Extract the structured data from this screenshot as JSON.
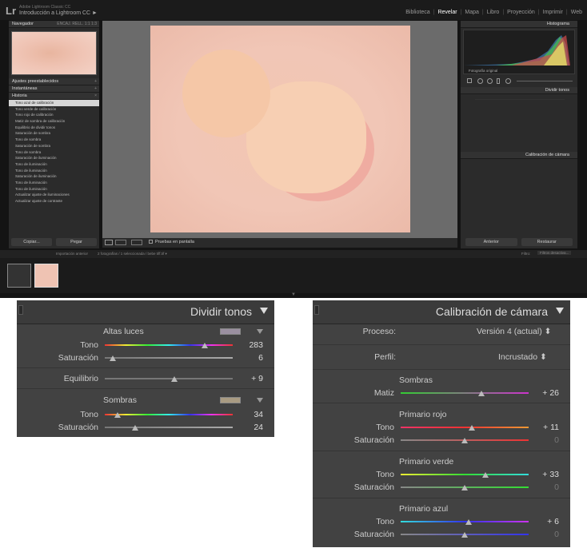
{
  "app": {
    "logo": "Lr",
    "catalog": "Adobe Lightroom Classic CC",
    "title": "Introducción a Lightroom CC ►"
  },
  "modules": [
    "Biblioteca",
    "Revelar",
    "Mapa",
    "Libro",
    "Proyección",
    "Imprimir",
    "Web"
  ],
  "active_module": "Revelar",
  "left": {
    "navigator": "Navegador",
    "nav_opts": "ENCAJ. RELL. 1:1 1:3",
    "presets": "Ajustes preestablecidos",
    "snapshots": "Instantáneas",
    "history": "Historia",
    "history_items": [
      "Tono azul de calibración",
      "Tono verde de calibración",
      "Tono rojo de calibración",
      "Matiz de sombra de calibración",
      "Equilibrio de dividir tonos",
      "Saturación de sombra",
      "Tono de sombra",
      "Saturación de sombra",
      "Tono de sombra",
      "Saturación de iluminación",
      "Tono de iluminación",
      "Tono de iluminación",
      "Saturación de iluminación",
      "Tono de iluminación",
      "Tono de iluminación",
      "Actualizar ajuste de iluminaciones",
      "Actualizar ajuste de contraste"
    ],
    "copy": "Copiar...",
    "paste": "Pegar"
  },
  "toolbar": {
    "soft_proof": "Pruebas en pantalla"
  },
  "right": {
    "histogram": "Histograma",
    "original": "Fotografía original",
    "split": "Dividir tonos",
    "calib": "Calibración de cámara",
    "prev": "Anterior",
    "reset": "Restaurar"
  },
  "filmstrip": {
    "source": "Importación anterior",
    "info": "2 fotografías / 1 seleccionada / bebe tiff.tif ▾",
    "filter": "Filtro:",
    "filter_val": "Filtros desactiva..."
  },
  "split_panel": {
    "title": "Dividir tonos",
    "highlights": "Altas luces",
    "hl_swatch": "#9a8fa0",
    "hl_tone_label": "Tono",
    "hl_tone": "283",
    "hl_tone_pct": 0.78,
    "hl_sat_label": "Saturación",
    "hl_sat": "6",
    "hl_sat_pct": 0.06,
    "balance_label": "Equilibrio",
    "balance": "+ 9",
    "balance_pct": 0.545,
    "shadows": "Sombras",
    "sh_swatch": "#a99b82",
    "sh_tone_label": "Tono",
    "sh_tone": "34",
    "sh_tone_pct": 0.1,
    "sh_sat_label": "Saturación",
    "sh_sat": "24",
    "sh_sat_pct": 0.24
  },
  "calib_panel": {
    "title": "Calibración de cámara",
    "process_label": "Proceso:",
    "process": "Versión 4 (actual) ⬍",
    "profile_label": "Perfil:",
    "profile": "Incrustado ⬍",
    "shadows": "Sombras",
    "tint_label": "Matiz",
    "tint": "+ 26",
    "tint_pct": 0.63,
    "red": "Primario rojo",
    "red_hue_label": "Tono",
    "red_hue": "+ 11",
    "red_hue_pct": 0.555,
    "red_sat_label": "Saturación",
    "red_sat": "0",
    "red_sat_pct": 0.5,
    "green": "Primario verde",
    "green_hue_label": "Tono",
    "green_hue": "+ 33",
    "green_hue_pct": 0.665,
    "green_sat_label": "Saturación",
    "green_sat": "0",
    "green_sat_pct": 0.5,
    "blue": "Primario azul",
    "blue_hue_label": "Tono",
    "blue_hue": "+ 6",
    "blue_hue_pct": 0.53,
    "blue_sat_label": "Saturación",
    "blue_sat": "0",
    "blue_sat_pct": 0.5
  }
}
